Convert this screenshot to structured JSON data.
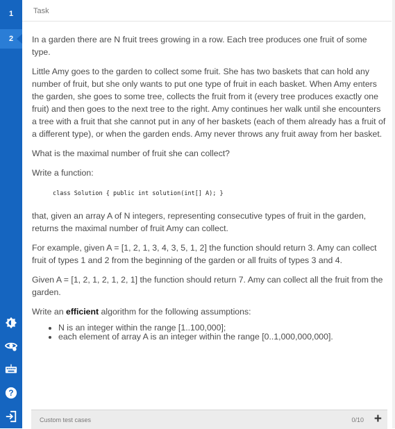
{
  "sidebar": {
    "tasks": [
      "1",
      "2"
    ]
  },
  "header": {
    "title": "Task"
  },
  "task": {
    "p1": "In a garden there are N fruit trees growing in a row. Each tree produces one fruit of some type.",
    "p2": "Little Amy goes to the garden to collect some fruit. She has two baskets that can hold any number of fruit, but she only wants to put one type of fruit in each basket. When Amy enters the garden, she goes to some tree, collects the fruit from it (every tree produces exactly one fruit) and then goes to the next tree to the right. Amy continues her walk until she encounters a tree with a fruit that she cannot put in any of her baskets (each of them already has a fruit of a different type), or when the garden ends. Amy never throws any fruit away from her basket.",
    "p3": "What is the maximal number of fruit she can collect?",
    "p4": "Write a function:",
    "code": "class Solution { public int solution(int[] A); }",
    "p5": "that, given an array A of N integers, representing consecutive types of fruit in the garden, returns the maximal number of fruit Amy can collect.",
    "p6": "For example, given A = [1, 2, 1, 3, 4, 3, 5, 1, 2] the function should return 3. Amy can collect fruit of types 1 and 2 from the beginning of the garden or all fruits of types 3 and 4.",
    "p7": "Given A = [1, 2, 1, 2, 1, 2, 1] the function should return 7. Amy can collect all the fruit from the garden.",
    "p8_pre": "Write an ",
    "p8_bold": "efficient",
    "p8_post": " algorithm for the following assumptions:",
    "assumptions": [
      "N is an integer within the range [1..100,000];",
      "each element of array A is an integer within the range [0..1,000,000,000]."
    ]
  },
  "footer": {
    "label": "Custom test cases",
    "count": "0/10",
    "add": "+"
  },
  "colors": {
    "sidebar": "#1565c0",
    "active_task": "#2a7dd6"
  },
  "icons": [
    "brightness-icon",
    "eye-settings-icon",
    "keyboard-icon",
    "help-icon",
    "exit-icon"
  ]
}
